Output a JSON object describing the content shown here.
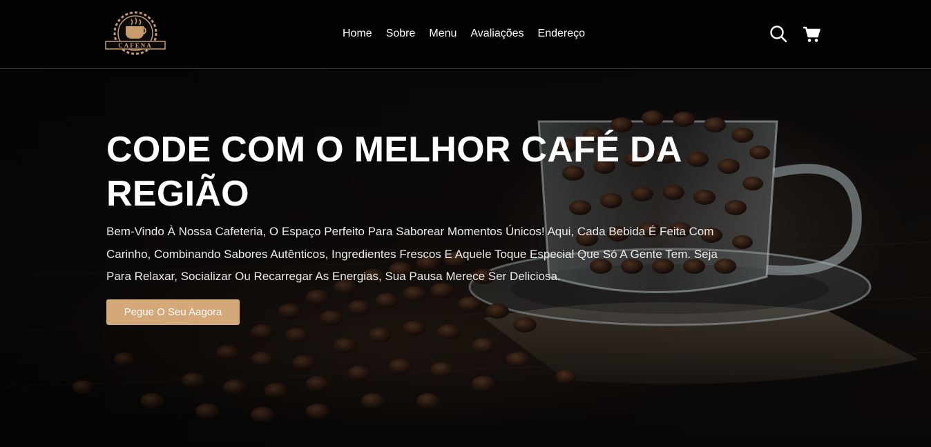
{
  "brand": {
    "logo_text": "CAFENA",
    "accent_color": "#d4a878"
  },
  "nav": {
    "items": [
      {
        "label": "Home"
      },
      {
        "label": "Sobre"
      },
      {
        "label": "Menu"
      },
      {
        "label": "Avaliações"
      },
      {
        "label": "Endereço"
      }
    ]
  },
  "header_icons": {
    "search": "search-icon",
    "cart": "cart-icon"
  },
  "hero": {
    "title": "CODE COM O MELHOR CAFÉ DA REGIÃO",
    "text": "Bem-Vindo À Nossa Cafeteria, O Espaço Perfeito Para Saborear Momentos Únicos! Aqui, Cada Bebida É Feita Com Carinho, Combinando Sabores Autênticos, Ingredientes Frescos E Aquele Toque Especial Que Só A Gente Tem. Seja Para Relaxar, Socializar Ou Recarregar As Energias, Sua Pausa Merece Ser Deliciosa.",
    "cta_label": "Pegue O Seu Aagora"
  }
}
